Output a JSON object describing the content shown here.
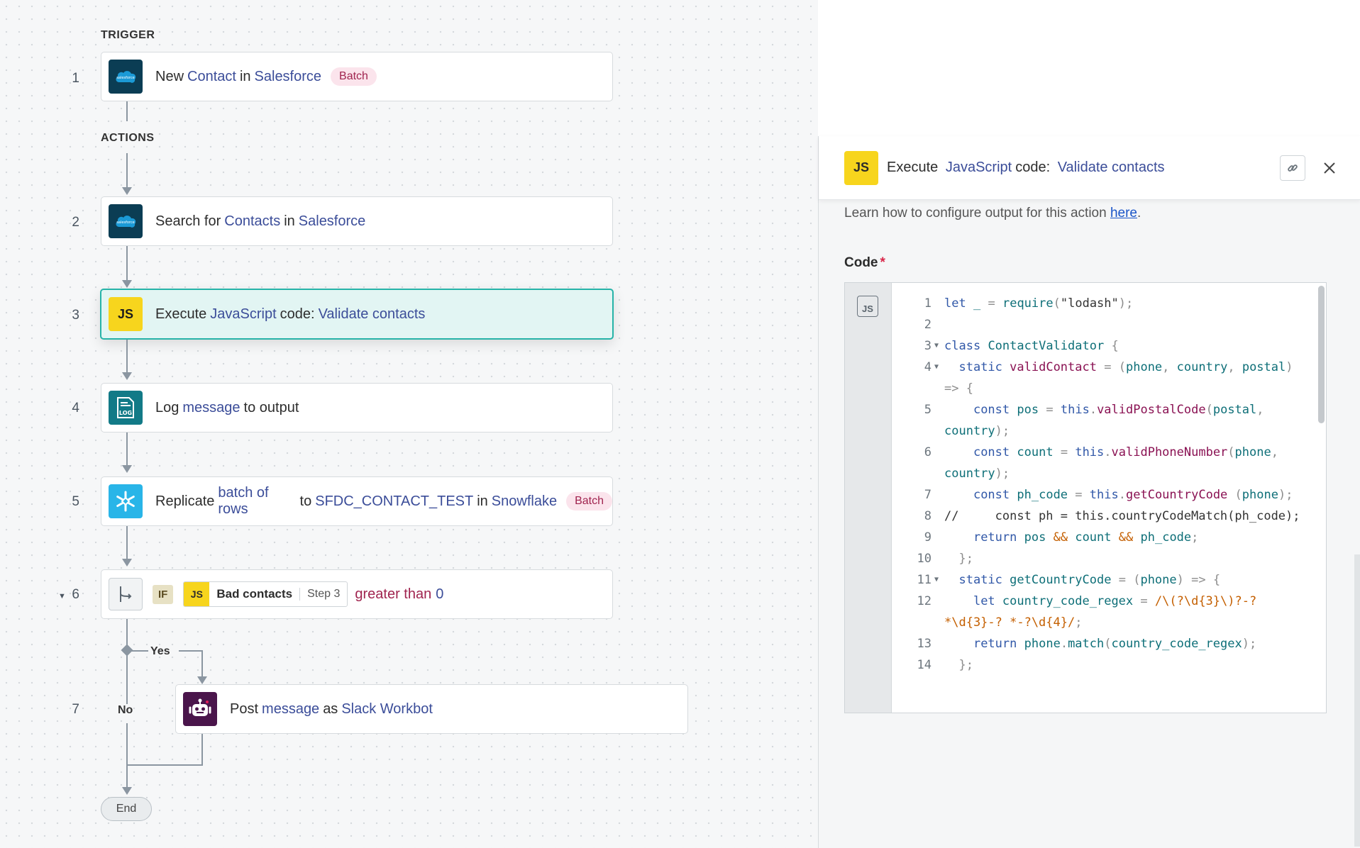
{
  "canvas": {
    "trigger_label": "TRIGGER",
    "actions_label": "ACTIONS",
    "steps": [
      {
        "num": "1",
        "parts": [
          "New",
          "Contact",
          "in",
          "Salesforce"
        ],
        "badge": "Batch",
        "icon": "salesforce-icon"
      },
      {
        "num": "2",
        "parts": [
          "Search for",
          "Contacts",
          "in",
          "Salesforce"
        ],
        "icon": "salesforce-icon"
      },
      {
        "num": "3",
        "parts": [
          "Execute",
          "JavaScript",
          "code:",
          "Validate contacts"
        ],
        "icon": "javascript-icon",
        "icon_text": "JS"
      },
      {
        "num": "4",
        "parts": [
          "Log",
          "message",
          "to output"
        ],
        "icon": "log-icon"
      },
      {
        "num": "5",
        "parts": [
          "Replicate",
          "batch of rows",
          "to",
          "SFDC_CONTACT_TEST",
          "in",
          "Snowflake"
        ],
        "badge": "Batch",
        "icon": "snowflake-icon"
      },
      {
        "num": "6",
        "if_tag": "IF",
        "pill_icon_text": "JS",
        "pill_name": "Bad contacts",
        "pill_step": "Step 3",
        "operator": "greater than",
        "value": "0",
        "icon": "branch-icon"
      },
      {
        "num": "7",
        "parts": [
          "Post",
          "message",
          "as",
          "Slack Workbot"
        ],
        "icon": "slack-workbot-icon"
      }
    ],
    "yes_label": "Yes",
    "no_label": "No",
    "end_label": "End"
  },
  "panel": {
    "icon_text": "JS",
    "title_parts": [
      "Execute",
      "JavaScript",
      "code:",
      "Validate contacts"
    ],
    "help_text": "Learn how to configure output for this action",
    "help_link": "here",
    "code_label": "Code",
    "required_mark": "*",
    "lang_badge": "JS",
    "code_lines": [
      {
        "n": "1",
        "fold": ""
      },
      {
        "n": "2",
        "fold": ""
      },
      {
        "n": "3",
        "fold": "▼"
      },
      {
        "n": "4",
        "fold": "▼"
      },
      {
        "n": "5",
        "fold": ""
      },
      {
        "n": "6",
        "fold": ""
      },
      {
        "n": "7",
        "fold": ""
      },
      {
        "n": "8",
        "fold": ""
      },
      {
        "n": "9",
        "fold": ""
      },
      {
        "n": "10",
        "fold": ""
      },
      {
        "n": "11",
        "fold": "▼"
      },
      {
        "n": "12",
        "fold": ""
      },
      {
        "n": "13",
        "fold": ""
      },
      {
        "n": "14",
        "fold": ""
      }
    ]
  },
  "colors": {
    "accent": "#26b3a8",
    "link": "#3b4d99",
    "badge_bg": "#fbe4ec",
    "badge_text": "#a0244f",
    "js_yellow": "#f7d51d"
  }
}
